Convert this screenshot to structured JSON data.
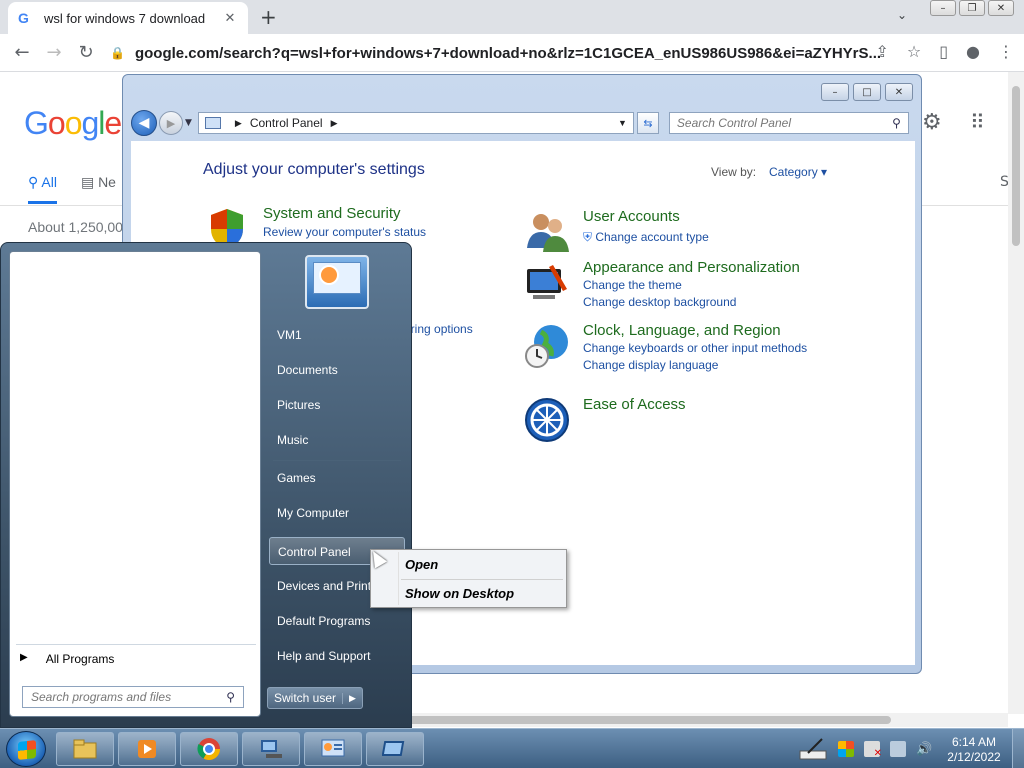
{
  "browser": {
    "tab_title": "wsl for windows 7 download",
    "tab_favicon": "G",
    "url": "google.com/search?q=wsl+for+windows+7+download+no&rlz=1C1GCEA_enUS986US986&ei=aZYHYrS..."
  },
  "google": {
    "logo": "Google",
    "tab_all": "All",
    "tab_news": "Ne",
    "results_count": "About 1,250,00",
    "more_label": "S"
  },
  "control_panel": {
    "breadcrumb": "Control Panel",
    "search_placeholder": "Search Control Panel",
    "heading": "Adjust your computer's settings",
    "view_by_label": "View by:",
    "view_by_value": "Category",
    "categories": [
      {
        "name": "System and Security",
        "links": [
          "Review your computer's status"
        ]
      },
      {
        "name": "User Accounts",
        "links": [
          "Change account type"
        ]
      },
      {
        "name": "Appearance and Personalization",
        "links": [
          "Change the theme",
          "Change desktop background"
        ]
      },
      {
        "name": "Clock, Language, and Region",
        "links": [
          "Change keyboards or other input methods",
          "Change display language"
        ]
      },
      {
        "name": "Ease of Access",
        "links": []
      }
    ],
    "partial_link": "aring options"
  },
  "start_menu": {
    "items": [
      "VM1",
      "Documents",
      "Pictures",
      "Music",
      "Games",
      "My Computer",
      "Control Panel",
      "Devices and Printers",
      "Default Programs",
      "Help and Support"
    ],
    "all_programs": "All Programs",
    "search_placeholder": "Search programs and files",
    "switch_user": "Switch user"
  },
  "context_menu": {
    "items": [
      "Open",
      "Show on Desktop"
    ]
  },
  "taskbar": {
    "time": "6:14 AM",
    "date": "2/12/2022"
  },
  "colors": {
    "link_blue": "#1e50a2",
    "category_green": "#1e6b1e",
    "heading_blue": "#1e3287"
  }
}
